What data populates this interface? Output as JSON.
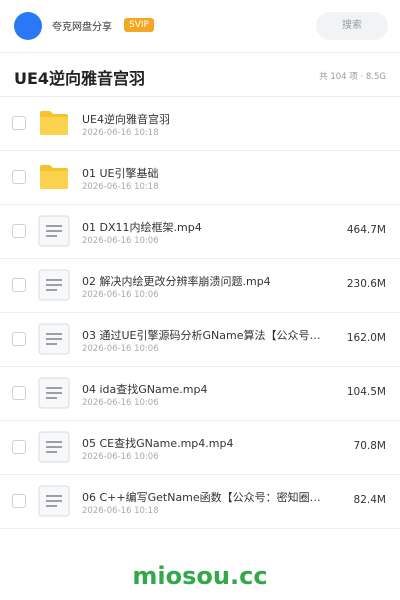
{
  "header": {
    "brand": "夸克网盘分享",
    "badge": "SVIP",
    "search_placeholder": "搜索"
  },
  "folder": {
    "title": "UE4逆向雅音宫羽",
    "meta": "共 104 项 · 8.5G"
  },
  "files": [
    {
      "type": "folder",
      "icon": "folder-icon",
      "name": "UE4逆向雅音宫羽",
      "date": "2026-06-16 10:18",
      "size": ""
    },
    {
      "type": "folder",
      "icon": "folder-icon",
      "name": "01 UE引擎基础",
      "date": "2026-06-16 10:18",
      "size": ""
    },
    {
      "type": "file",
      "icon": "document-icon",
      "name": "01 DX11内绘框架.mp4",
      "date": "2026-06-16 10:06",
      "size": "464.7M"
    },
    {
      "type": "file",
      "icon": "document-icon",
      "name": "02 解决内绘更改分辨率崩溃问题.mp4",
      "date": "2026-06-16 10:06",
      "size": "230.6M"
    },
    {
      "type": "file",
      "icon": "document-icon",
      "name": "03 通过UE引擎源码分析GName算法【公众号：…",
      "date": "2026-06-16 10:06",
      "size": "162.0M"
    },
    {
      "type": "file",
      "icon": "document-icon",
      "name": "04 ida查找GName.mp4",
      "date": "2026-06-16 10:06",
      "size": "104.5M"
    },
    {
      "type": "file",
      "icon": "document-icon",
      "name": "05 CE查找GName.mp4.mp4",
      "date": "2026-06-16 10:06",
      "size": "70.8M"
    },
    {
      "type": "file",
      "icon": "document-icon",
      "name": "06 C++编写GetName函数【公众号：密知圈…",
      "date": "2026-06-16 10:18",
      "size": "82.4M"
    }
  ],
  "watermark": "miosou.cc",
  "colors": {
    "accent": "#2b78f6",
    "badge": "#f5a623",
    "folder": "#f8c22e",
    "watermark": "#33a84b"
  }
}
